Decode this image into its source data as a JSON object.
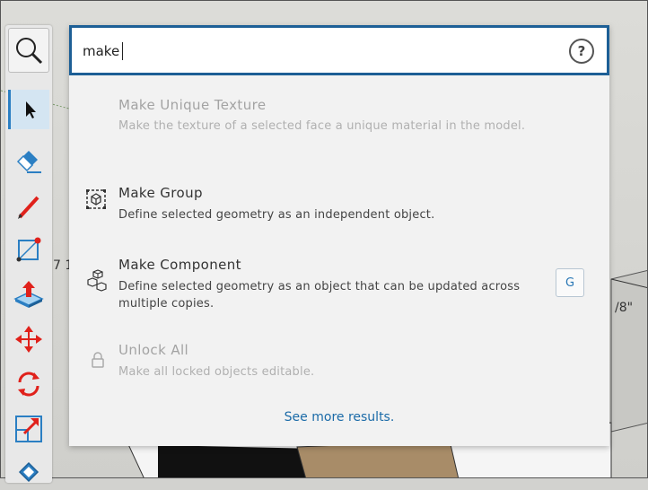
{
  "search": {
    "value": "make",
    "help_glyph": "?"
  },
  "results": [
    {
      "title": "Make Unique Texture",
      "description": "Make the texture of a selected face a unique material in the model.",
      "enabled": false,
      "icon": "none"
    },
    {
      "title": "Make Group",
      "description": "Define selected geometry as an independent object.",
      "enabled": true,
      "icon": "make-group-icon"
    },
    {
      "title": "Make Component",
      "description": "Define selected geometry as an object that can be updated across multiple copies.",
      "enabled": true,
      "icon": "make-component-icon",
      "shortcut": "G"
    },
    {
      "title": "Unlock All",
      "description": "Make all locked objects editable.",
      "enabled": false,
      "icon": "lock-icon"
    }
  ],
  "see_more": "See more results.",
  "background_text": {
    "left_dim": "7 1",
    "right_dim": "/8\""
  },
  "tools": [
    "search-icon",
    "select-arrow-icon",
    "eraser-icon",
    "pencil-icon",
    "rectangle-icon",
    "push-pull-icon",
    "move-icon",
    "rotate-icon",
    "scale-icon",
    "paint-bucket-icon"
  ],
  "colors": {
    "accent": "#1d5f96",
    "link": "#1b6ba8",
    "tool_red": "#e0211b",
    "tool_blue": "#2b7fc3"
  }
}
